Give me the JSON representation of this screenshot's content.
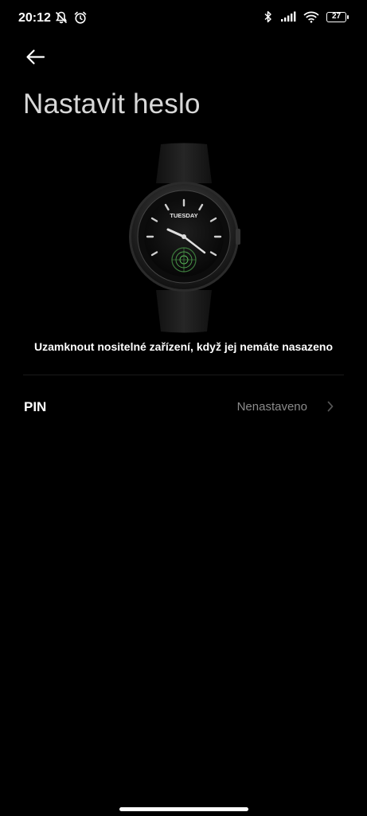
{
  "status_bar": {
    "time": "20:12",
    "battery_level": "27",
    "left_icons": [
      "notifications-off-icon",
      "alarm-icon"
    ],
    "right_icons": [
      "bluetooth-icon",
      "signal-icon",
      "wifi-icon",
      "battery-icon"
    ]
  },
  "header": {
    "back_icon": "back-arrow-icon",
    "title": "Nastavit heslo"
  },
  "watch": {
    "day_label": "TUESDAY"
  },
  "description": "Uzamknout nositelné zařízení, když jej nemáte nasazeno",
  "pin_setting": {
    "label": "PIN",
    "value": "Nenastaveno",
    "chevron_icon": "chevron-right-icon"
  },
  "colors": {
    "background": "#000000",
    "text_primary": "#ffffff",
    "text_secondary": "#8a8a8a",
    "title": "#d8d8d8"
  }
}
